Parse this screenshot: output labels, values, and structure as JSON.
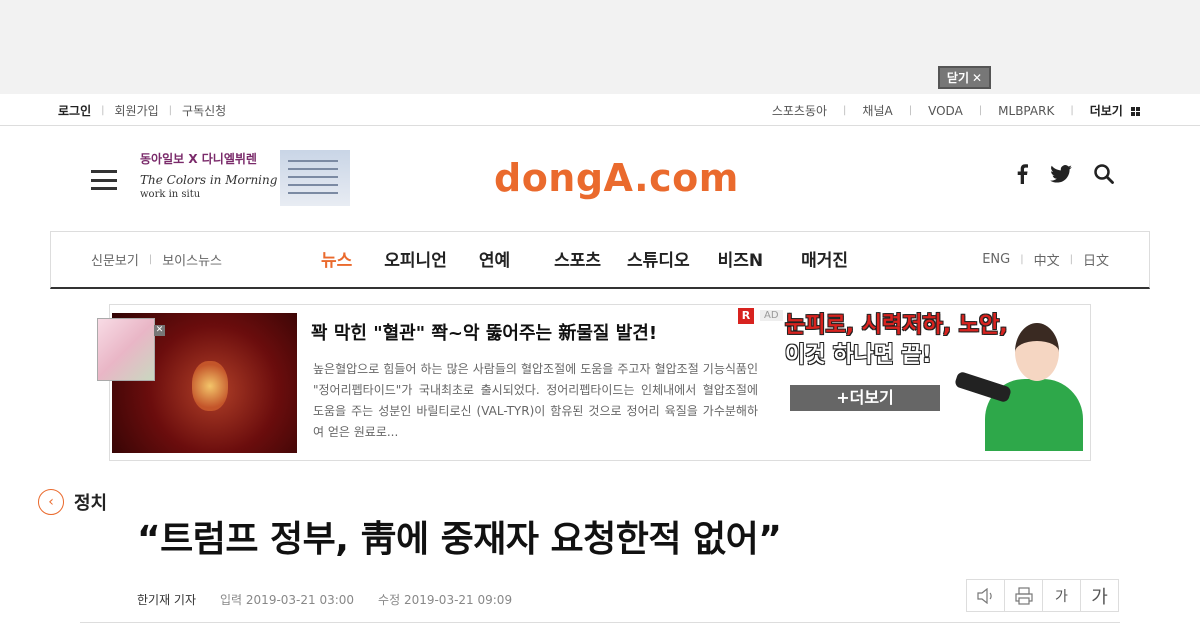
{
  "top_ad": {
    "close_label": "닫기"
  },
  "utility": {
    "left": [
      "로그인",
      "회원가입",
      "구독신청"
    ],
    "right": [
      "스포츠동아",
      "채널A",
      "VODA",
      "MLBPARK"
    ],
    "more_label": "더보기"
  },
  "header": {
    "promo": {
      "line1": "동아일보 X 다니엘뷔렌",
      "line2": "The Colors in Morning Calm",
      "line3": "work in situ"
    },
    "logo": "dongA.com"
  },
  "nav": {
    "sub": [
      "신문보기",
      "보이스뉴스"
    ],
    "main": [
      "뉴스",
      "오피니언",
      "연예",
      "스포츠",
      "스튜디오",
      "비즈N",
      "매거진"
    ],
    "active": "뉴스",
    "lang": [
      "ENG",
      "中文",
      "日文"
    ]
  },
  "ad": {
    "title": "꽉 막힌 \"혈관\" 쫙~악 뚫어주는 新물질 발견!",
    "body": "높은혈압으로 힘들어 하는 많은 사람들의 혈압조절에 도움을 주고자 혈압조절 기능식품인 \"정어리펩타이드\"가 국내최초로 출시되었다. 정어리펩타이드는 인체내에서 혈압조절에 도움을 주는 성분인 바릴티로신 (VAL-TYR)이 함유된 것으로 정어리 육질을 가수분해하여 얻은 원료로...",
    "r_badge": "R",
    "ad_badge": "AD",
    "right_line1": "눈피로, 시력저하, 노안,",
    "right_line2": "이것 하나면 끝!",
    "more_button": "+더보기"
  },
  "article": {
    "category": "정치",
    "headline": "“트럼프 정부, 靑에 중재자 요청한적 없어”",
    "reporter": "한기재 기자",
    "input": "입력 2019-03-21 03:00",
    "modified": "수정 2019-03-21 09:09"
  },
  "tools": {
    "font_small": "가",
    "font_large": "가"
  }
}
